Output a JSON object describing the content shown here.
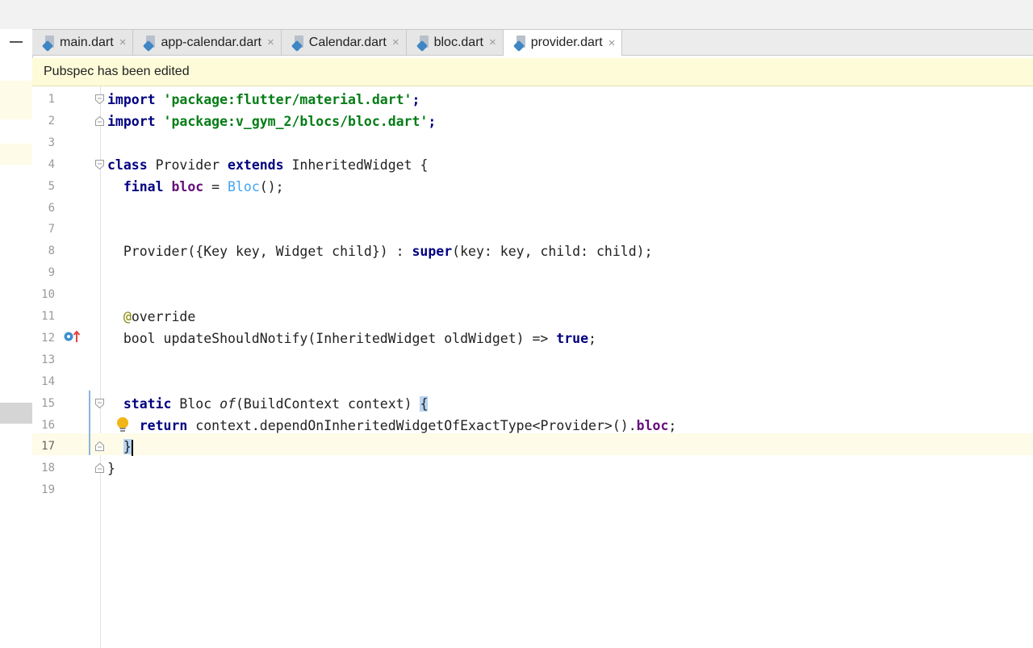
{
  "tabs": [
    {
      "label": "main.dart",
      "icon": "dart-file-icon",
      "active": false
    },
    {
      "label": "app-calendar.dart",
      "icon": "dart-file-icon",
      "active": false
    },
    {
      "label": "Calendar.dart",
      "icon": "dart-file-icon",
      "active": false
    },
    {
      "label": "bloc.dart",
      "icon": "dart-file-icon",
      "active": false
    },
    {
      "label": "provider.dart",
      "icon": "dart-file-icon",
      "active": true
    }
  ],
  "tab_close_glyph": "×",
  "notification": {
    "text": "Pubspec has been edited"
  },
  "editor": {
    "line_numbers": [
      "1",
      "2",
      "3",
      "4",
      "5",
      "6",
      "7",
      "8",
      "9",
      "10",
      "11",
      "12",
      "13",
      "14",
      "15",
      "16",
      "17",
      "18",
      "19"
    ],
    "current_line": 17,
    "lines": [
      [
        {
          "t": "import ",
          "c": "kw"
        },
        {
          "t": "'package:flutter/material.dart'",
          "c": "str"
        },
        {
          "t": ";",
          "c": "kw"
        }
      ],
      [
        {
          "t": "import ",
          "c": "kw"
        },
        {
          "t": "'package:v_gym_2/blocs/bloc.dart'",
          "c": "str"
        },
        {
          "t": ";",
          "c": "kw"
        }
      ],
      [],
      [
        {
          "t": "class ",
          "c": "kw"
        },
        {
          "t": "Provider ",
          "c": ""
        },
        {
          "t": "extends ",
          "c": "kw"
        },
        {
          "t": "InheritedWidget {",
          "c": ""
        }
      ],
      [
        {
          "t": "  ",
          "c": ""
        },
        {
          "t": "final ",
          "c": "kw"
        },
        {
          "t": "bloc",
          "c": "fld"
        },
        {
          "t": " = ",
          "c": ""
        },
        {
          "t": "Bloc",
          "c": "cls"
        },
        {
          "t": "();",
          "c": ""
        }
      ],
      [],
      [],
      [
        {
          "t": "  Provider({Key key, Widget child}) : ",
          "c": ""
        },
        {
          "t": "super",
          "c": "kw"
        },
        {
          "t": "(key: key, child: child);",
          "c": ""
        }
      ],
      [],
      [],
      [
        {
          "t": "  ",
          "c": ""
        },
        {
          "t": "@",
          "c": "ann"
        },
        {
          "t": "override",
          "c": ""
        }
      ],
      [
        {
          "t": "  bool updateShouldNotify(InheritedWidget oldWidget) => ",
          "c": ""
        },
        {
          "t": "true",
          "c": "kw"
        },
        {
          "t": ";",
          "c": ""
        }
      ],
      [],
      [],
      [
        {
          "t": "  ",
          "c": ""
        },
        {
          "t": "static ",
          "c": "kw"
        },
        {
          "t": "Bloc ",
          "c": ""
        },
        {
          "t": "of",
          "c": "it"
        },
        {
          "t": "(BuildContext context) ",
          "c": ""
        },
        {
          "t": "{",
          "c": "brace-hl"
        }
      ],
      [
        {
          "t": "    ",
          "c": ""
        },
        {
          "t": "return ",
          "c": "kw"
        },
        {
          "t": "context.dependOnInheritedWidgetOfExactType<Provider>().",
          "c": ""
        },
        {
          "t": "bloc",
          "c": "fld"
        },
        {
          "t": ";",
          "c": ""
        }
      ],
      [
        {
          "t": "  ",
          "c": ""
        },
        {
          "t": "}",
          "c": "brace-hl"
        },
        {
          "t": "",
          "c": "cursor"
        }
      ],
      [
        {
          "t": "}",
          "c": ""
        }
      ],
      []
    ]
  },
  "gutter_icons": {
    "line12": "implements-override-icon",
    "line16": "intention-bulb-icon"
  }
}
